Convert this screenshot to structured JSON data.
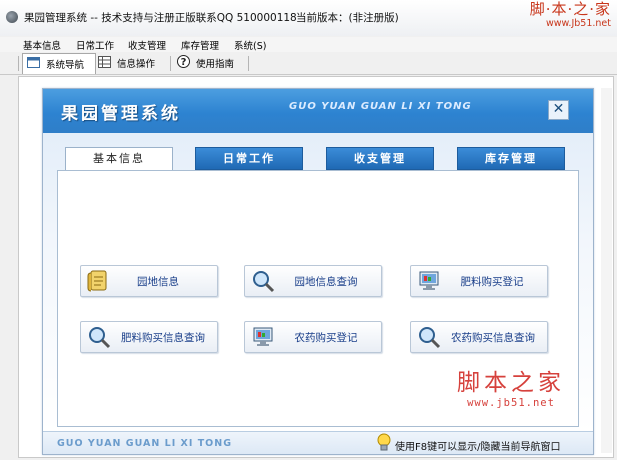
{
  "window": {
    "title": "果园管理系统 -- 技术支持与注册正版联系QQ 510000118",
    "version": "当前版本：(非注册版)"
  },
  "watermark_top": {
    "text": "脚·本·之·家",
    "url": "www.Jb51.net"
  },
  "menu": [
    {
      "label": "基本信息"
    },
    {
      "label": "日常工作"
    },
    {
      "label": "收支管理"
    },
    {
      "label": "库存管理"
    },
    {
      "label": "系统(S)"
    }
  ],
  "toolbar": [
    {
      "label": "系统导航",
      "icon": "window-icon"
    },
    {
      "label": "信息操作",
      "icon": "grid-icon"
    },
    {
      "label": "使用指南",
      "icon": "help-icon"
    }
  ],
  "banner": {
    "title": "果园管理系统",
    "subtitle": "GUO YUAN GUAN LI XI TONG"
  },
  "tabs": [
    {
      "label": "基本信息",
      "active": true
    },
    {
      "label": "日常工作",
      "active": false
    },
    {
      "label": "收支管理",
      "active": false
    },
    {
      "label": "库存管理",
      "active": false
    }
  ],
  "buttons": [
    {
      "label": "园地信息",
      "icon": "document-icon"
    },
    {
      "label": "园地信息查询",
      "icon": "magnifier-icon"
    },
    {
      "label": "肥料购买登记",
      "icon": "monitor-icon"
    },
    {
      "label": "肥料购买信息查询",
      "icon": "magnifier-icon"
    },
    {
      "label": "农药购买登记",
      "icon": "monitor-icon"
    },
    {
      "label": "农药购买信息查询",
      "icon": "magnifier-icon"
    }
  ],
  "footer": {
    "subtitle": "GUO YUAN GUAN LI XI TONG",
    "hint": "使用F8键可以显示/隐藏当前导航窗口"
  },
  "watermark_bottom": {
    "text": "脚本之家",
    "url": "www.jb51.net"
  },
  "colors": {
    "banner_blue": "#2d83d1",
    "tab_blue": "#1f69b4",
    "button_text": "#1a3f8a",
    "watermark_red": "#d6413c"
  }
}
